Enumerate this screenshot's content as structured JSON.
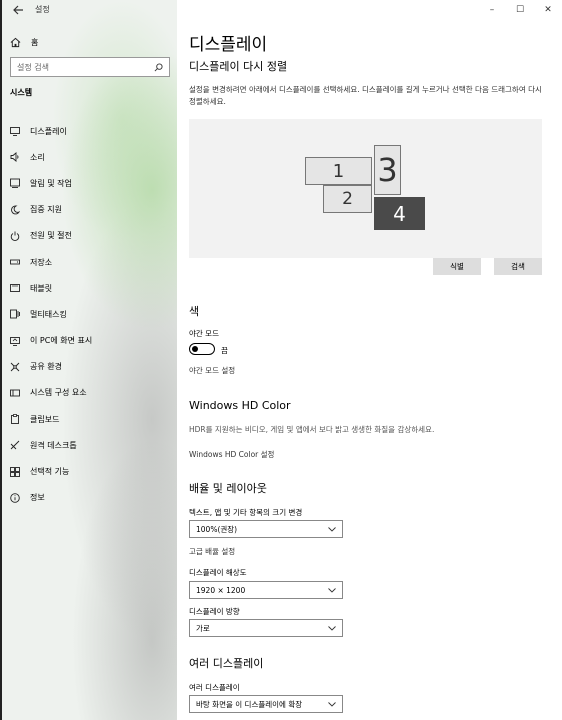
{
  "window": {
    "title": "설정",
    "minimize": "–",
    "maximize": "☐",
    "close": "✕"
  },
  "sidebar": {
    "home": "홈",
    "search_placeholder": "설정 검색",
    "section": "시스템",
    "items": [
      {
        "label": "디스플레이",
        "icon": "monitor-icon"
      },
      {
        "label": "소리",
        "icon": "speaker-icon"
      },
      {
        "label": "알림 및 작업",
        "icon": "notification-icon"
      },
      {
        "label": "집중 지원",
        "icon": "moon-icon"
      },
      {
        "label": "전원 및 절전",
        "icon": "power-icon"
      },
      {
        "label": "저장소",
        "icon": "storage-icon"
      },
      {
        "label": "태블릿",
        "icon": "tablet-icon"
      },
      {
        "label": "멀티태스킹",
        "icon": "multitasking-icon"
      },
      {
        "label": "이 PC에 화면 표시",
        "icon": "project-icon"
      },
      {
        "label": "공유 환경",
        "icon": "shared-icon"
      },
      {
        "label": "시스템 구성 요소",
        "icon": "components-icon"
      },
      {
        "label": "클립보드",
        "icon": "clipboard-icon"
      },
      {
        "label": "원격 데스크톱",
        "icon": "remote-icon"
      },
      {
        "label": "선택적 기능",
        "icon": "features-icon"
      },
      {
        "label": "정보",
        "icon": "info-icon"
      }
    ]
  },
  "main": {
    "title": "디스플레이",
    "rearrange": {
      "heading": "디스플레이 다시 정렬",
      "description": "설정을 변경하려면 아래에서 디스플레이를 선택하세요. 디스플레이를 길게 누르거나 선택한 다음 드래그하여 다시 정렬하세요.",
      "monitors": [
        "1",
        "2",
        "3",
        "4"
      ],
      "identify": "식별",
      "detect": "검색"
    },
    "color": {
      "heading": "색",
      "night_light_label": "야간 모드",
      "night_light_state": "끔",
      "night_light_settings": "야간 모드 설정"
    },
    "hdr": {
      "heading": "Windows HD Color",
      "description": "HDR를 지원하는 비디오, 게임 및 앱에서 보다 밝고 생생한 화질을 감상하세요.",
      "settings_link": "Windows HD Color 설정"
    },
    "scale": {
      "heading": "배율 및 레이아웃",
      "size_label": "텍스트, 앱 및 기타 항목의 크기 변경",
      "size_value": "100%(권장)",
      "advanced_link": "고급 배율 설정",
      "resolution_label": "디스플레이 해상도",
      "resolution_value": "1920 × 1200",
      "orientation_label": "디스플레이 방향",
      "orientation_value": "가로"
    },
    "multi": {
      "heading": "여러 디스플레이",
      "label": "여러 디스플레이",
      "value": "바탕 화면을 이 디스플레이에 확장"
    }
  }
}
